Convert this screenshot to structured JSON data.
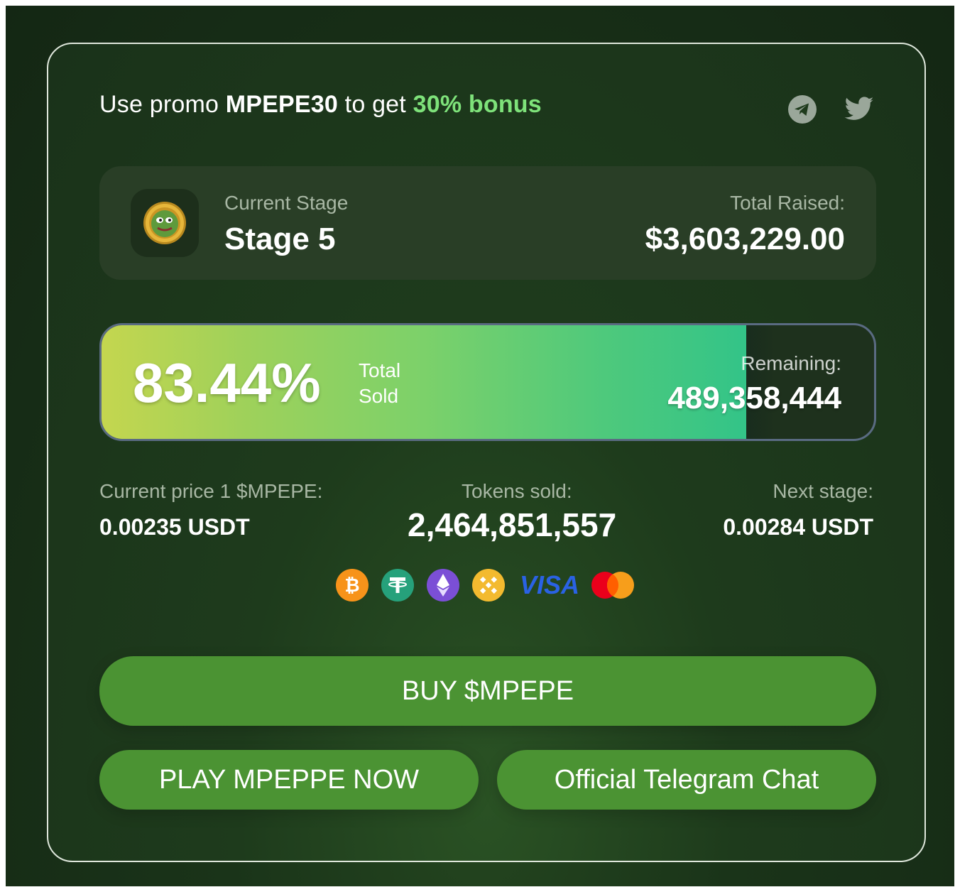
{
  "colors": {
    "background": "#142714",
    "card": "#1e3b1c",
    "accent_green": "#7ee27a",
    "button_green": "#4b9333",
    "progress_start": "#c4d64f",
    "progress_end": "#33c488"
  },
  "promo": {
    "prefix": "Use promo",
    "code": "MPEPE30",
    "middle": "to get",
    "bonus": "30% bonus"
  },
  "social": [
    {
      "icon": "telegram-icon"
    },
    {
      "icon": "twitter-icon"
    }
  ],
  "stage": {
    "label": "Current Stage",
    "value": "Stage 5",
    "coin_icon": "mpepe-coin-icon"
  },
  "raised": {
    "label": "Total Raised:",
    "value": "$3,603,229.00"
  },
  "progress": {
    "percent_text": "83.44%",
    "fraction": 0.8344,
    "sold_label": "Total Sold",
    "remaining_label": "Remaining:",
    "remaining_value": "489,358,444"
  },
  "stats": {
    "price_label": "Current price 1 $MPEPE:",
    "price_value": "0.00235 USDT",
    "sold_label": "Tokens sold:",
    "sold_value": "2,464,851,557",
    "next_label": "Next stage:",
    "next_value": "0.00284 USDT"
  },
  "payments": [
    "bitcoin-icon",
    "tether-icon",
    "ethereum-icon",
    "bnb-icon",
    "visa-icon",
    "mastercard-icon"
  ],
  "buttons": {
    "buy": "BUY $MPEPE",
    "play": "PLAY MPEPPE NOW",
    "telegram": "Official Telegram Chat"
  }
}
